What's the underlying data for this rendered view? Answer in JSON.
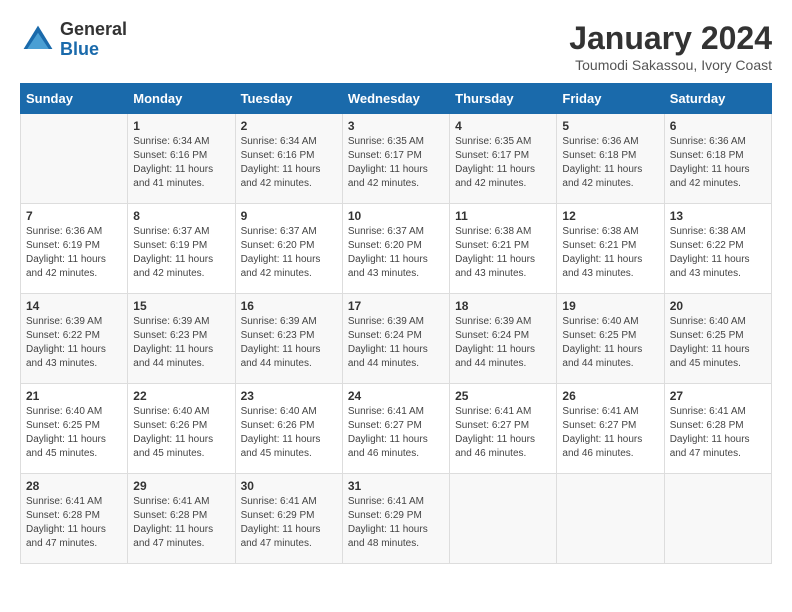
{
  "logo": {
    "general": "General",
    "blue": "Blue"
  },
  "title": "January 2024",
  "location": "Toumodi Sakassou, Ivory Coast",
  "days_of_week": [
    "Sunday",
    "Monday",
    "Tuesday",
    "Wednesday",
    "Thursday",
    "Friday",
    "Saturday"
  ],
  "weeks": [
    [
      {
        "day": "",
        "info": ""
      },
      {
        "day": "1",
        "info": "Sunrise: 6:34 AM\nSunset: 6:16 PM\nDaylight: 11 hours\nand 41 minutes."
      },
      {
        "day": "2",
        "info": "Sunrise: 6:34 AM\nSunset: 6:16 PM\nDaylight: 11 hours\nand 42 minutes."
      },
      {
        "day": "3",
        "info": "Sunrise: 6:35 AM\nSunset: 6:17 PM\nDaylight: 11 hours\nand 42 minutes."
      },
      {
        "day": "4",
        "info": "Sunrise: 6:35 AM\nSunset: 6:17 PM\nDaylight: 11 hours\nand 42 minutes."
      },
      {
        "day": "5",
        "info": "Sunrise: 6:36 AM\nSunset: 6:18 PM\nDaylight: 11 hours\nand 42 minutes."
      },
      {
        "day": "6",
        "info": "Sunrise: 6:36 AM\nSunset: 6:18 PM\nDaylight: 11 hours\nand 42 minutes."
      }
    ],
    [
      {
        "day": "7",
        "info": "Sunrise: 6:36 AM\nSunset: 6:19 PM\nDaylight: 11 hours\nand 42 minutes."
      },
      {
        "day": "8",
        "info": "Sunrise: 6:37 AM\nSunset: 6:19 PM\nDaylight: 11 hours\nand 42 minutes."
      },
      {
        "day": "9",
        "info": "Sunrise: 6:37 AM\nSunset: 6:20 PM\nDaylight: 11 hours\nand 42 minutes."
      },
      {
        "day": "10",
        "info": "Sunrise: 6:37 AM\nSunset: 6:20 PM\nDaylight: 11 hours\nand 43 minutes."
      },
      {
        "day": "11",
        "info": "Sunrise: 6:38 AM\nSunset: 6:21 PM\nDaylight: 11 hours\nand 43 minutes."
      },
      {
        "day": "12",
        "info": "Sunrise: 6:38 AM\nSunset: 6:21 PM\nDaylight: 11 hours\nand 43 minutes."
      },
      {
        "day": "13",
        "info": "Sunrise: 6:38 AM\nSunset: 6:22 PM\nDaylight: 11 hours\nand 43 minutes."
      }
    ],
    [
      {
        "day": "14",
        "info": "Sunrise: 6:39 AM\nSunset: 6:22 PM\nDaylight: 11 hours\nand 43 minutes."
      },
      {
        "day": "15",
        "info": "Sunrise: 6:39 AM\nSunset: 6:23 PM\nDaylight: 11 hours\nand 44 minutes."
      },
      {
        "day": "16",
        "info": "Sunrise: 6:39 AM\nSunset: 6:23 PM\nDaylight: 11 hours\nand 44 minutes."
      },
      {
        "day": "17",
        "info": "Sunrise: 6:39 AM\nSunset: 6:24 PM\nDaylight: 11 hours\nand 44 minutes."
      },
      {
        "day": "18",
        "info": "Sunrise: 6:39 AM\nSunset: 6:24 PM\nDaylight: 11 hours\nand 44 minutes."
      },
      {
        "day": "19",
        "info": "Sunrise: 6:40 AM\nSunset: 6:25 PM\nDaylight: 11 hours\nand 44 minutes."
      },
      {
        "day": "20",
        "info": "Sunrise: 6:40 AM\nSunset: 6:25 PM\nDaylight: 11 hours\nand 45 minutes."
      }
    ],
    [
      {
        "day": "21",
        "info": "Sunrise: 6:40 AM\nSunset: 6:25 PM\nDaylight: 11 hours\nand 45 minutes."
      },
      {
        "day": "22",
        "info": "Sunrise: 6:40 AM\nSunset: 6:26 PM\nDaylight: 11 hours\nand 45 minutes."
      },
      {
        "day": "23",
        "info": "Sunrise: 6:40 AM\nSunset: 6:26 PM\nDaylight: 11 hours\nand 45 minutes."
      },
      {
        "day": "24",
        "info": "Sunrise: 6:41 AM\nSunset: 6:27 PM\nDaylight: 11 hours\nand 46 minutes."
      },
      {
        "day": "25",
        "info": "Sunrise: 6:41 AM\nSunset: 6:27 PM\nDaylight: 11 hours\nand 46 minutes."
      },
      {
        "day": "26",
        "info": "Sunrise: 6:41 AM\nSunset: 6:27 PM\nDaylight: 11 hours\nand 46 minutes."
      },
      {
        "day": "27",
        "info": "Sunrise: 6:41 AM\nSunset: 6:28 PM\nDaylight: 11 hours\nand 47 minutes."
      }
    ],
    [
      {
        "day": "28",
        "info": "Sunrise: 6:41 AM\nSunset: 6:28 PM\nDaylight: 11 hours\nand 47 minutes."
      },
      {
        "day": "29",
        "info": "Sunrise: 6:41 AM\nSunset: 6:28 PM\nDaylight: 11 hours\nand 47 minutes."
      },
      {
        "day": "30",
        "info": "Sunrise: 6:41 AM\nSunset: 6:29 PM\nDaylight: 11 hours\nand 47 minutes."
      },
      {
        "day": "31",
        "info": "Sunrise: 6:41 AM\nSunset: 6:29 PM\nDaylight: 11 hours\nand 48 minutes."
      },
      {
        "day": "",
        "info": ""
      },
      {
        "day": "",
        "info": ""
      },
      {
        "day": "",
        "info": ""
      }
    ]
  ]
}
